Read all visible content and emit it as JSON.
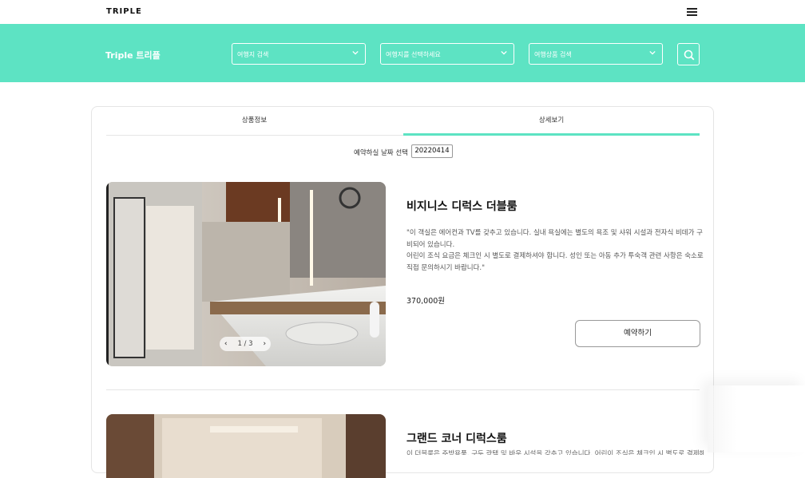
{
  "header": {
    "logo": "TRIPLE",
    "menu_icon": "hamburger-icon"
  },
  "search": {
    "brand": "Triple 트리플",
    "destination_placeholder": "여행지 검색",
    "region_placeholder": "여행지를 선택하세요",
    "product_placeholder": "여행상품 검색",
    "search_icon": "search-icon",
    "accent_color": "#5de3c3"
  },
  "tabs": {
    "info": "상품정보",
    "detail": "상세보기",
    "active": "상세보기"
  },
  "booking": {
    "date_label": "예약하실 날짜 선택",
    "date_value": "20220414"
  },
  "rooms": [
    {
      "title": "비지니스 디럭스 더블룸",
      "desc_line1": "\"이 객실은 에어컨과 TV를 갖추고 있습니다. 실내 욕실에는 별도의 욕조 및 샤워 시설과 전자식 비데가 구",
      "desc_line2": "비되어 있습니다.",
      "desc_line3": "어린이 조식 요금은 체크인 시 별도로 결제하셔야 합니다. 성인 또는 아동 추가 투숙객 관련 사항은 숙소로",
      "desc_line4": "직접 문의하시기 바랍니다.\"",
      "price": "370,000원",
      "reserve_label": "예약하기",
      "pager": "1 / 3",
      "prev_icon": "chevron-left-icon",
      "next_icon": "chevron-right-icon"
    },
    {
      "title": "그랜드 코너 디럭스룸",
      "desc_line1": "이 더블룸은 주방용품, 구두 광택 및 바우 시설을 갖추고 있습니다. 어린이 조식은 체크인 시 별도로 결제해"
    }
  ]
}
